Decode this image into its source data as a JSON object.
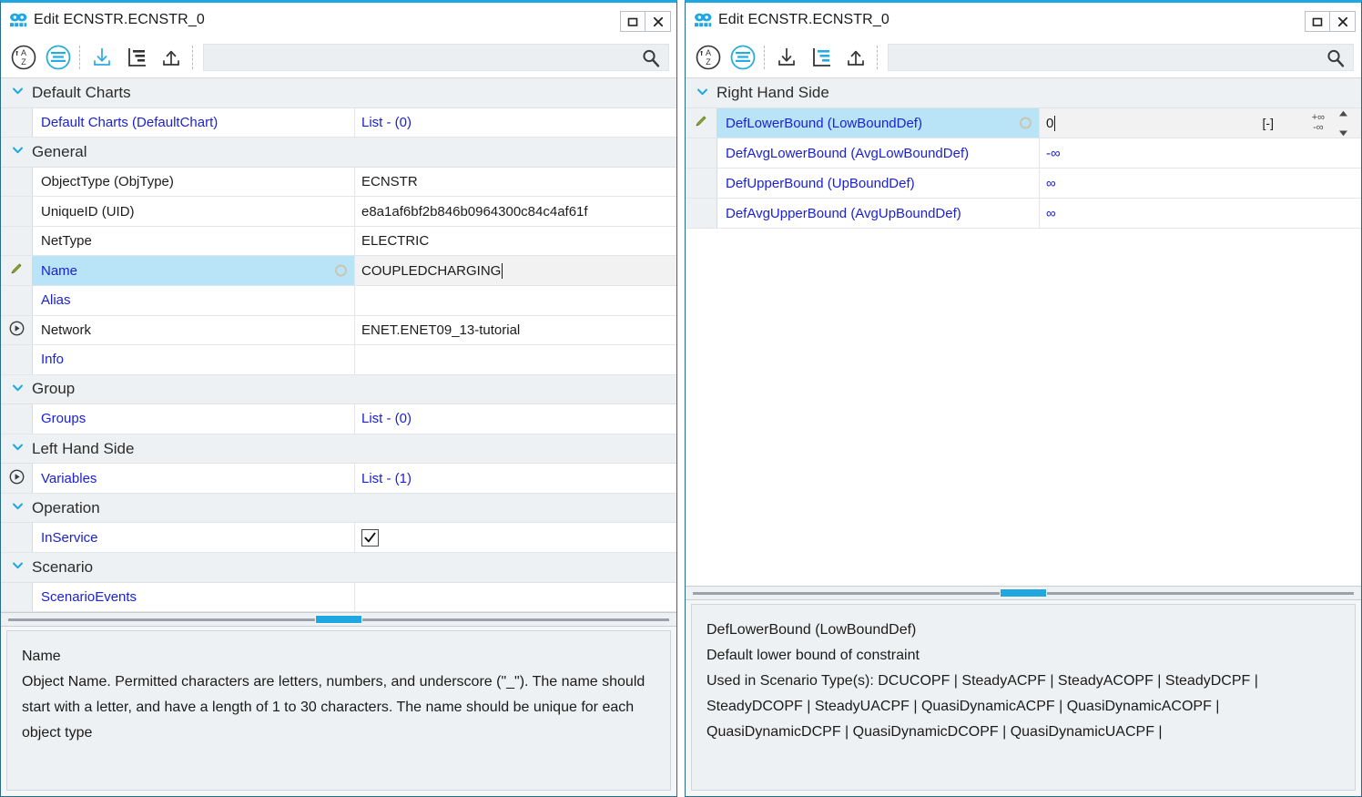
{
  "theme": {
    "accent": "#1ea7e0",
    "link_blue": "#1b21d6",
    "selection_blue": "#b9e4f7",
    "group_header_bg": "#eef1f3",
    "window_border": "#2a6b8a"
  },
  "windows": [
    {
      "id": "left",
      "title": "Edit ECNSTR.ECNSTR_0",
      "app_icon": "mask-icon",
      "titlebar_buttons": [
        {
          "name": "maximize-button",
          "glyph": "maximize-icon"
        },
        {
          "name": "close-button",
          "glyph": "close-icon"
        }
      ],
      "toolbar": {
        "buttons": [
          {
            "name": "sort-alphabetical-button",
            "icon": "sort-az-icon",
            "active": false
          },
          {
            "name": "group-by-category-button",
            "icon": "categorized-list-icon",
            "active": true
          },
          {
            "name": "collapse-all-button",
            "icon": "arrow-down-into-line-icon",
            "active": true
          },
          {
            "name": "tree-view-button",
            "icon": "hierarchy-icon",
            "active": false
          },
          {
            "name": "expand-all-button",
            "icon": "arrow-up-from-line-icon",
            "active": false
          }
        ],
        "search": {
          "value": "",
          "placeholder": ""
        },
        "search_icon": "search-icon"
      },
      "groups": [
        {
          "label": "Default Charts",
          "rows": [
            {
              "gutter": "",
              "name": "Default Charts (DefaultChart)",
              "name_color": "blue",
              "value": "List - (0)",
              "value_color": "blue",
              "type": "text",
              "selected": false
            }
          ]
        },
        {
          "label": "General",
          "rows": [
            {
              "gutter": "",
              "name": "ObjectType (ObjType)",
              "name_color": "black",
              "value": "ECNSTR",
              "value_color": "black",
              "type": "text",
              "selected": false
            },
            {
              "gutter": "",
              "name": "UniqueID (UID)",
              "name_color": "black",
              "value": "e8a1af6bf2b846b0964300c84c4af61f",
              "value_color": "black",
              "type": "text",
              "selected": false
            },
            {
              "gutter": "",
              "name": "NetType",
              "name_color": "black",
              "value": "ELECTRIC",
              "value_color": "black",
              "type": "text",
              "selected": false
            },
            {
              "gutter": "pencil",
              "name": "Name",
              "name_color": "blue",
              "value": "COUPLEDCHARGING",
              "value_color": "black",
              "type": "editing",
              "selected": true
            },
            {
              "gutter": "",
              "name": "Alias",
              "name_color": "blue",
              "value": "",
              "value_color": "black",
              "type": "text",
              "selected": false
            },
            {
              "gutter": "expand",
              "name": "Network",
              "name_color": "black",
              "value": "ENET.ENET09_13-tutorial",
              "value_color": "black",
              "type": "text",
              "selected": false
            },
            {
              "gutter": "",
              "name": "Info",
              "name_color": "blue",
              "value": "",
              "value_color": "black",
              "type": "text",
              "selected": false
            }
          ]
        },
        {
          "label": "Group",
          "rows": [
            {
              "gutter": "",
              "name": "Groups",
              "name_color": "blue",
              "value": "List - (0)",
              "value_color": "blue",
              "type": "text",
              "selected": false
            }
          ]
        },
        {
          "label": "Left Hand Side",
          "rows": [
            {
              "gutter": "expand",
              "name": "Variables",
              "name_color": "blue",
              "value": "List - (1)",
              "value_color": "blue",
              "type": "text",
              "selected": false
            }
          ]
        },
        {
          "label": "Operation",
          "rows": [
            {
              "gutter": "",
              "name": "InService",
              "name_color": "blue",
              "value": "",
              "value_color": "black",
              "type": "checkbox",
              "checked": true,
              "selected": false
            }
          ]
        },
        {
          "label": "Scenario",
          "rows": [
            {
              "gutter": "",
              "name": "ScenarioEvents",
              "name_color": "blue",
              "value": "",
              "value_color": "black",
              "type": "text",
              "selected": false
            }
          ]
        }
      ],
      "description": [
        "Name",
        "Object Name. Permitted characters are letters, numbers, and underscore (\"_\"). The name should start with a letter, and have a length of 1 to 30 characters. The name should be unique for each object type"
      ]
    },
    {
      "id": "right",
      "title": "Edit ECNSTR.ECNSTR_0",
      "app_icon": "mask-icon",
      "titlebar_buttons": [
        {
          "name": "maximize-button",
          "glyph": "maximize-icon"
        },
        {
          "name": "close-button",
          "glyph": "close-icon"
        }
      ],
      "toolbar": {
        "buttons": [
          {
            "name": "sort-alphabetical-button",
            "icon": "sort-az-icon",
            "active": false
          },
          {
            "name": "group-by-category-button",
            "icon": "categorized-list-icon",
            "active": true
          },
          {
            "name": "collapse-all-button",
            "icon": "arrow-down-into-line-icon",
            "active": false
          },
          {
            "name": "tree-view-button",
            "icon": "hierarchy-icon",
            "active": true
          },
          {
            "name": "expand-all-button",
            "icon": "arrow-up-from-line-icon",
            "active": false
          }
        ],
        "search": {
          "value": "",
          "placeholder": ""
        },
        "search_icon": "search-icon"
      },
      "groups": [
        {
          "label": "Right Hand Side",
          "rows": [
            {
              "gutter": "pencil",
              "name": "DefLowerBound (LowBoundDef)",
              "name_color": "blue",
              "value": "0",
              "value_color": "black",
              "type": "spinner",
              "selected": true,
              "unit": "[-]",
              "inf_plus": "+∞",
              "inf_minus": "-∞"
            },
            {
              "gutter": "",
              "name": "DefAvgLowerBound (AvgLowBoundDef)",
              "name_color": "blue",
              "value": "-∞",
              "value_color": "blue",
              "type": "text",
              "selected": false
            },
            {
              "gutter": "",
              "name": "DefUpperBound (UpBoundDef)",
              "name_color": "blue",
              "value": "∞",
              "value_color": "blue",
              "type": "text",
              "selected": false
            },
            {
              "gutter": "",
              "name": "DefAvgUpperBound (AvgUpBoundDef)",
              "name_color": "blue",
              "value": "∞",
              "value_color": "blue",
              "type": "text",
              "selected": false
            }
          ]
        }
      ],
      "description": [
        "DefLowerBound (LowBoundDef)",
        "Default lower bound of constraint",
        "Used in Scenario Type(s): DCUCOPF | SteadyACPF | SteadyACOPF | SteadyDCPF | SteadyDCOPF | SteadyUACPF | QuasiDynamicACPF | QuasiDynamicACOPF | QuasiDynamicDCPF | QuasiDynamicDCOPF | QuasiDynamicUACPF |"
      ]
    }
  ]
}
